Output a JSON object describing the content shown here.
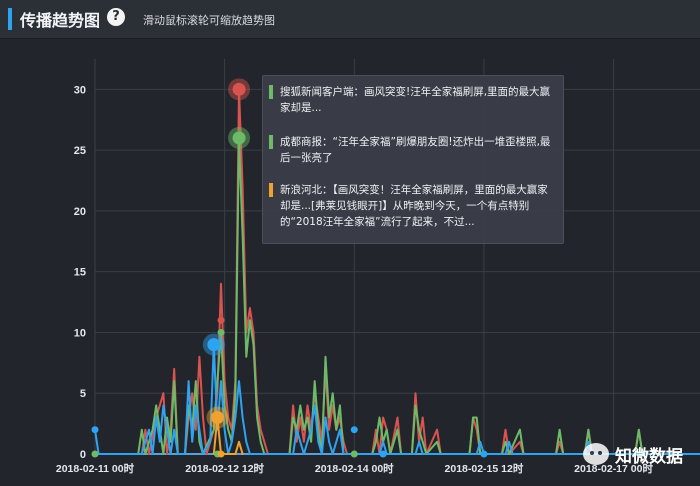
{
  "header": {
    "title": "传播趋势图",
    "help_icon": "?",
    "hint": "滑动鼠标滚轮可缩放趋势图"
  },
  "tooltip": {
    "items": [
      {
        "color": "#6dbb69",
        "text": "搜狐新闻客户端：画风突变!汪年全家福刷屏,里面的最大赢家却是..."
      },
      {
        "color": "#6dbb69",
        "text": "成都商报：“汪年全家福”刷爆朋友圈!还炸出一堆歪楼照,最后一张亮了"
      },
      {
        "color": "#f0a22e",
        "text": "新浪河北：【画风突变！汪年全家福刷屏，里面的最大赢家却是...[弗莱见钱眼开]】从昨晚到今天，一个有点特别的“2018汪年全家福”流行了起来，不过..."
      }
    ]
  },
  "watermark": {
    "text": "知微数据",
    "icon": "wechat-icon"
  },
  "chart_data": {
    "type": "line",
    "title": "",
    "xlabel": "",
    "ylabel": "",
    "ylim": [
      0,
      32
    ],
    "yticks": [
      0,
      5,
      10,
      15,
      20,
      25,
      30
    ],
    "x_start": "2018-02-11 00时",
    "x_unit": "hour",
    "xlim": [
      0,
      168
    ],
    "xticks": [
      {
        "x": 0,
        "label": "2018-02-11 00时"
      },
      {
        "x": 36,
        "label": "2018-02-12 12时"
      },
      {
        "x": 72,
        "label": "2018-02-14 00时"
      },
      {
        "x": 108,
        "label": "2018-02-15 12时"
      },
      {
        "x": 144,
        "label": "2018-02-17 00时"
      }
    ],
    "grid": true,
    "colors": {
      "red": "#d9534f",
      "green": "#6dbb69",
      "blue": "#2ea3f2",
      "orange": "#f0a22e",
      "axis": "#5a9fd6",
      "grid": "#3a3e47"
    },
    "series": [
      {
        "color": "#d9534f",
        "points": [
          [
            0,
            0
          ],
          [
            13,
            0
          ],
          [
            14,
            2
          ],
          [
            15,
            0
          ],
          [
            17,
            3
          ],
          [
            18,
            4
          ],
          [
            19,
            5
          ],
          [
            20,
            0
          ],
          [
            21,
            2
          ],
          [
            22,
            7
          ],
          [
            23,
            0
          ],
          [
            25,
            0
          ],
          [
            26,
            3
          ],
          [
            27,
            5
          ],
          [
            28,
            2
          ],
          [
            29,
            8
          ],
          [
            30,
            3
          ],
          [
            31,
            0
          ],
          [
            33,
            2
          ],
          [
            34,
            5
          ],
          [
            35,
            14
          ],
          [
            36,
            6
          ],
          [
            37,
            3
          ],
          [
            38,
            2
          ],
          [
            39,
            6
          ],
          [
            40,
            30
          ],
          [
            41,
            22
          ],
          [
            42,
            10
          ],
          [
            43,
            12
          ],
          [
            44,
            10
          ],
          [
            45,
            4
          ],
          [
            46,
            2
          ],
          [
            47,
            1
          ],
          [
            48,
            0
          ],
          [
            54,
            0
          ],
          [
            55,
            4
          ],
          [
            56,
            1
          ],
          [
            57,
            3
          ],
          [
            58,
            1
          ],
          [
            59,
            4
          ],
          [
            60,
            2
          ],
          [
            61,
            5
          ],
          [
            62,
            3
          ],
          [
            63,
            1
          ],
          [
            64,
            7
          ],
          [
            65,
            2
          ],
          [
            66,
            4
          ],
          [
            67,
            2
          ],
          [
            68,
            3
          ],
          [
            69,
            1
          ],
          [
            70,
            0
          ],
          [
            77,
            0
          ],
          [
            78,
            2
          ],
          [
            79,
            0
          ],
          [
            80,
            3
          ],
          [
            81,
            2
          ],
          [
            82,
            0
          ],
          [
            84,
            3
          ],
          [
            85,
            0
          ],
          [
            88,
            0
          ],
          [
            89,
            5
          ],
          [
            90,
            1
          ],
          [
            91,
            3
          ],
          [
            92,
            0
          ],
          [
            95,
            2
          ],
          [
            96,
            0
          ],
          [
            104,
            0
          ],
          [
            105,
            3
          ],
          [
            106,
            2
          ],
          [
            107,
            0
          ],
          [
            113,
            0
          ],
          [
            114,
            2
          ],
          [
            115,
            0
          ],
          [
            118,
            1
          ],
          [
            119,
            0
          ],
          [
            128,
            0
          ],
          [
            129,
            1
          ],
          [
            130,
            0
          ],
          [
            136,
            0
          ],
          [
            137,
            2
          ],
          [
            138,
            0
          ],
          [
            150,
            0
          ],
          [
            151,
            2
          ],
          [
            152,
            0
          ],
          [
            168,
            0
          ]
        ]
      },
      {
        "color": "#6dbb69",
        "points": [
          [
            0,
            0
          ],
          [
            12,
            0
          ],
          [
            13,
            2
          ],
          [
            14,
            0
          ],
          [
            16,
            2
          ],
          [
            17,
            4
          ],
          [
            18,
            2
          ],
          [
            19,
            0
          ],
          [
            20,
            3
          ],
          [
            21,
            1
          ],
          [
            22,
            6
          ],
          [
            23,
            0
          ],
          [
            25,
            0
          ],
          [
            26,
            4
          ],
          [
            27,
            2
          ],
          [
            28,
            6
          ],
          [
            29,
            1
          ],
          [
            30,
            0
          ],
          [
            33,
            2
          ],
          [
            34,
            6
          ],
          [
            35,
            10
          ],
          [
            36,
            4
          ],
          [
            37,
            2
          ],
          [
            38,
            1
          ],
          [
            39,
            5
          ],
          [
            40,
            26
          ],
          [
            41,
            18
          ],
          [
            42,
            8
          ],
          [
            43,
            11
          ],
          [
            44,
            9
          ],
          [
            45,
            3
          ],
          [
            46,
            1
          ],
          [
            47,
            0
          ],
          [
            54,
            0
          ],
          [
            55,
            3
          ],
          [
            56,
            2
          ],
          [
            57,
            4
          ],
          [
            58,
            2
          ],
          [
            59,
            3
          ],
          [
            60,
            1
          ],
          [
            61,
            6
          ],
          [
            62,
            2
          ],
          [
            63,
            0
          ],
          [
            64,
            8
          ],
          [
            65,
            3
          ],
          [
            66,
            5
          ],
          [
            67,
            2
          ],
          [
            68,
            4
          ],
          [
            69,
            0
          ],
          [
            77,
            0
          ],
          [
            78,
            1
          ],
          [
            79,
            3
          ],
          [
            80,
            1
          ],
          [
            81,
            2
          ],
          [
            82,
            0
          ],
          [
            84,
            2
          ],
          [
            85,
            0
          ],
          [
            88,
            0
          ],
          [
            89,
            4
          ],
          [
            90,
            2
          ],
          [
            91,
            1
          ],
          [
            92,
            0
          ],
          [
            95,
            1
          ],
          [
            96,
            0
          ],
          [
            104,
            0
          ],
          [
            105,
            3
          ],
          [
            106,
            3
          ],
          [
            107,
            0
          ],
          [
            113,
            0
          ],
          [
            114,
            1
          ],
          [
            115,
            0
          ],
          [
            118,
            2
          ],
          [
            119,
            0
          ],
          [
            128,
            0
          ],
          [
            129,
            2
          ],
          [
            130,
            0
          ],
          [
            136,
            0
          ],
          [
            137,
            2
          ],
          [
            138,
            0
          ],
          [
            150,
            0
          ],
          [
            151,
            2
          ],
          [
            152,
            0
          ],
          [
            168,
            0
          ]
        ]
      },
      {
        "color": "#2ea3f2",
        "points": [
          [
            0,
            2
          ],
          [
            1,
            0
          ],
          [
            13,
            0
          ],
          [
            14,
            1
          ],
          [
            15,
            2
          ],
          [
            16,
            0
          ],
          [
            17,
            3
          ],
          [
            18,
            1
          ],
          [
            19,
            4
          ],
          [
            20,
            2
          ],
          [
            21,
            0
          ],
          [
            22,
            2
          ],
          [
            23,
            0
          ],
          [
            25,
            0
          ],
          [
            26,
            6
          ],
          [
            27,
            1
          ],
          [
            28,
            4
          ],
          [
            29,
            2
          ],
          [
            30,
            0
          ],
          [
            32,
            1
          ],
          [
            33,
            9
          ],
          [
            34,
            2
          ],
          [
            35,
            6
          ],
          [
            36,
            2
          ],
          [
            37,
            0
          ],
          [
            38,
            1
          ],
          [
            39,
            3
          ],
          [
            40,
            6
          ],
          [
            41,
            3
          ],
          [
            42,
            1
          ],
          [
            43,
            0
          ],
          [
            55,
            0
          ],
          [
            56,
            2
          ],
          [
            57,
            1
          ],
          [
            58,
            0
          ],
          [
            60,
            2
          ],
          [
            61,
            4
          ],
          [
            62,
            1
          ],
          [
            63,
            0
          ],
          [
            64,
            3
          ],
          [
            65,
            1
          ],
          [
            66,
            0
          ],
          [
            68,
            2
          ],
          [
            69,
            0
          ],
          [
            79,
            0
          ],
          [
            80,
            1
          ],
          [
            81,
            0
          ],
          [
            89,
            0
          ],
          [
            90,
            1
          ],
          [
            91,
            0
          ],
          [
            106,
            0
          ],
          [
            107,
            1
          ],
          [
            108,
            0
          ],
          [
            114,
            0
          ],
          [
            115,
            1
          ],
          [
            116,
            0
          ],
          [
            136,
            0
          ],
          [
            137,
            1
          ],
          [
            138,
            0
          ],
          [
            168,
            0
          ]
        ]
      },
      {
        "color": "#f0a22e",
        "points": [
          [
            33,
            0
          ],
          [
            34,
            3
          ],
          [
            35,
            0
          ],
          [
            39,
            0
          ],
          [
            40,
            1
          ],
          [
            41,
            0
          ]
        ]
      }
    ],
    "highlight_points": [
      {
        "x": 40,
        "y": 30,
        "color": "#d9534f",
        "size": "large"
      },
      {
        "x": 40,
        "y": 26,
        "color": "#6dbb69",
        "size": "large"
      },
      {
        "x": 33,
        "y": 9,
        "color": "#2ea3f2",
        "size": "large"
      },
      {
        "x": 34,
        "y": 3,
        "color": "#f0a22e",
        "size": "large"
      },
      {
        "x": 0,
        "y": 2,
        "color": "#2ea3f2",
        "size": "small"
      },
      {
        "x": 0,
        "y": 0,
        "color": "#6dbb69",
        "size": "small"
      },
      {
        "x": 34,
        "y": 0,
        "color": "#6dbb69",
        "size": "small"
      },
      {
        "x": 35,
        "y": 10,
        "color": "#6dbb69",
        "size": "small"
      },
      {
        "x": 35,
        "y": 11,
        "color": "#d9534f",
        "size": "small"
      },
      {
        "x": 35,
        "y": 0,
        "color": "#f0a22e",
        "size": "small"
      },
      {
        "x": 72,
        "y": 2,
        "color": "#2ea3f2",
        "size": "small"
      },
      {
        "x": 72,
        "y": 0,
        "color": "#6dbb69",
        "size": "small"
      },
      {
        "x": 80,
        "y": 0,
        "color": "#2ea3f2",
        "size": "small"
      },
      {
        "x": 108,
        "y": 0,
        "color": "#2ea3f2",
        "size": "small"
      }
    ]
  }
}
